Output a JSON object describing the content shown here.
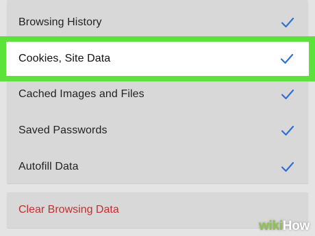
{
  "options": [
    {
      "label": "Browsing History",
      "checked": true
    },
    {
      "label": "Cookies, Site Data",
      "checked": true,
      "highlighted": true
    },
    {
      "label": "Cached Images and Files",
      "checked": true
    },
    {
      "label": "Saved Passwords",
      "checked": true
    },
    {
      "label": "Autofill Data",
      "checked": true
    }
  ],
  "clear_button": {
    "label": "Clear Browsing Data"
  },
  "watermark": {
    "wiki": "wiki",
    "how": "How"
  },
  "colors": {
    "background": "#e4e4e4",
    "card": "#d8d8d8",
    "highlight_border": "#5be33a",
    "check": "#2f6fd4",
    "clear_text": "#c0302c"
  },
  "icons": {
    "check": "check-icon"
  }
}
